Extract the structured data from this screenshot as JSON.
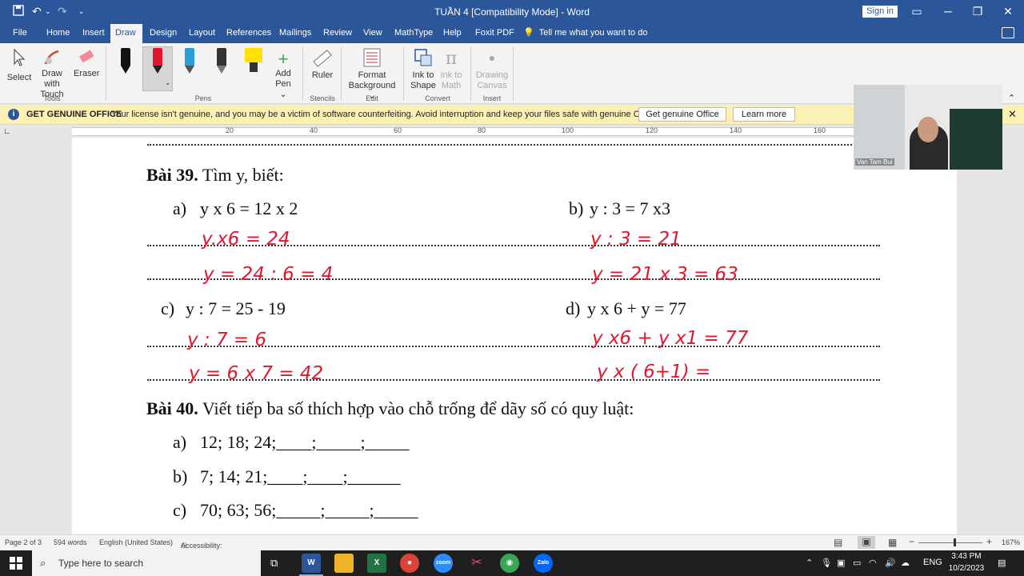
{
  "window": {
    "title": "TUẦN 4 [Compatibility Mode]  -  Word",
    "sign_in": "Sign in"
  },
  "quick_access": {
    "save_icon": "save-icon",
    "undo_icon": "undo-icon",
    "redo_icon": "redo-icon"
  },
  "tabs": [
    "File",
    "Home",
    "Insert",
    "Draw",
    "Design",
    "Layout",
    "References",
    "Mailings",
    "Review",
    "View",
    "MathType",
    "Help",
    "Foxit PDF"
  ],
  "active_tab": "Draw",
  "tell_me": "Tell me what you want to do",
  "ribbon": {
    "tools": {
      "select": "Select",
      "draw_touch_1": "Draw with",
      "draw_touch_2": "Touch",
      "eraser": "Eraser",
      "group": "Tools"
    },
    "pens": {
      "add_pen_1": "Add",
      "add_pen_2": "Pen",
      "group": "Pens",
      "colors": [
        "#111111",
        "#e0182e",
        "#2a9fd6",
        "#222222",
        "#ffe000"
      ]
    },
    "stencils": {
      "ruler": "Ruler",
      "group": "Stencils"
    },
    "edit": {
      "format_bg_1": "Format",
      "format_bg_2": "Background",
      "group": "Edit"
    },
    "convert": {
      "ink_shape_1": "Ink to",
      "ink_shape_2": "Shape",
      "ink_math_1": "Ink to",
      "ink_math_2": "Math",
      "group": "Convert"
    },
    "insert": {
      "drawing_canvas_1": "Drawing",
      "drawing_canvas_2": "Canvas",
      "group": "Insert"
    }
  },
  "genuine_bar": {
    "title": "GET GENUINE OFFICE",
    "message": "Your license isn't genuine, and you may be a victim of software counterfeiting. Avoid interruption and keep your files safe with genuine Office today.",
    "get_button": "Get genuine Office",
    "learn_button": "Learn more"
  },
  "ruler_numbers": [
    "20",
    "40",
    "60",
    "80",
    "100",
    "120",
    "140",
    "160"
  ],
  "webcam": {
    "name": "Van Tam Bui"
  },
  "document": {
    "bai39_title": "Bài 39.",
    "bai39_text": " Tìm y, biết:",
    "a_label": "a)",
    "a_expr": "y x 6 = 12 x 2",
    "b_label": "b)",
    "b_expr": "y : 3 = 7 x3",
    "c_label": "c)",
    "c_expr": "y : 7 = 25 - 19",
    "d_label": "d)",
    "d_expr": "y x 6 + y = 77",
    "bai40_title": "Bài 40.",
    "bai40_text": " Viết tiếp ba số thích hợp vào chỗ trống để dãy số có quy luật:",
    "seq_a_label": "a)",
    "seq_a": "12; 18; 24;____;_____;_____",
    "seq_b_label": "b)",
    "seq_b": "7; 14; 21;____;____;______",
    "seq_c_label": "c)",
    "seq_c": "70; 63; 56;_____;_____;_____"
  },
  "handwriting": {
    "a1": "y.x6  =  24",
    "a2": "y       =  24 : 6   =  4",
    "b1": "y : 3  =  21",
    "b2": "y      =  21 x 3   =    63",
    "c1": "y : 7  =        6",
    "c2": "y      =  6 x 7   =  42",
    "d1": "y x6 + y x1   =  77",
    "d2": "y x ( 6+1)   ="
  },
  "status": {
    "page": "Page 2 of 3",
    "words": "594 words",
    "language": "English (United States)",
    "accessibility": "Accessibility: Unavailable",
    "zoom": "167%"
  },
  "taskbar": {
    "search_placeholder": "Type here to search",
    "time": "3:43 PM",
    "date": "10/2/2023",
    "lang": "ENG",
    "apps": [
      "word-icon",
      "file-explorer-icon",
      "excel-icon",
      "chrome-icon",
      "zoom-icon",
      "snipping-icon",
      "photos-icon",
      "zalo-icon"
    ]
  }
}
